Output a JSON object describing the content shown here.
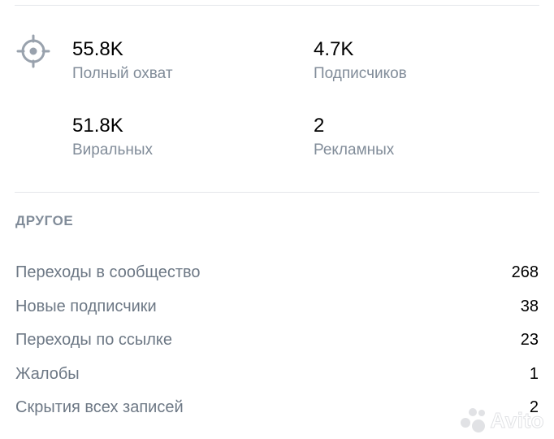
{
  "stats": {
    "total_reach": {
      "value": "55.8K",
      "label": "Полный охват"
    },
    "subscribers": {
      "value": "4.7K",
      "label": "Подписчиков"
    },
    "viral": {
      "value": "51.8K",
      "label": "Виральных"
    },
    "ads": {
      "value": "2",
      "label": "Рекламных"
    }
  },
  "other": {
    "title": "ДРУГОЕ",
    "rows": [
      {
        "label": "Переходы в сообщество",
        "value": "268"
      },
      {
        "label": "Новые подписчики",
        "value": "38"
      },
      {
        "label": "Переходы по ссылке",
        "value": "23"
      },
      {
        "label": "Жалобы",
        "value": "1"
      },
      {
        "label": "Скрытия всех записей",
        "value": "2"
      }
    ]
  },
  "icons": {
    "reach": "target-icon",
    "watermark": "avito-logo-icon"
  },
  "colors": {
    "label_gray": "#818c99",
    "row_label": "#6d7885",
    "value": "#000000",
    "divider": "#e4e6ea"
  },
  "watermark": {
    "text": "Avito"
  }
}
